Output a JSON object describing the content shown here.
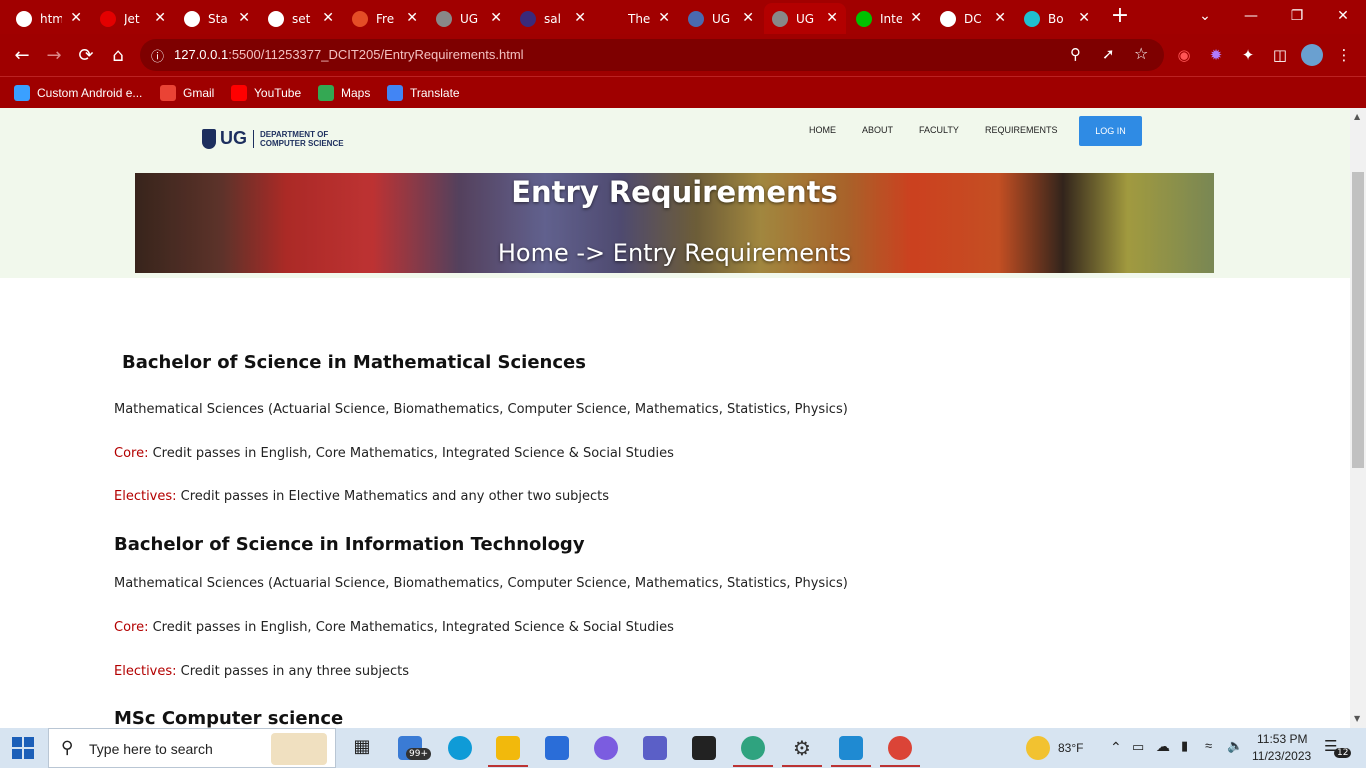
{
  "browser": {
    "tabs": [
      {
        "title": "htm",
        "icon": "google-icon",
        "color": "#ffffff"
      },
      {
        "title": "Jet",
        "icon": "swiss-flag-icon",
        "color": "#e30000"
      },
      {
        "title": "Sta",
        "icon": "github-icon",
        "color": "#ffffff"
      },
      {
        "title": "set",
        "icon": "google-icon",
        "color": "#ffffff"
      },
      {
        "title": "Fre",
        "icon": "html5-icon",
        "color": "#e44d26"
      },
      {
        "title": "UG",
        "icon": "globe-icon",
        "color": "#888888"
      },
      {
        "title": "sal",
        "icon": "ug-crest-icon",
        "color": "#3a2a7a"
      },
      {
        "title": "The",
        "icon": "blank-icon",
        "color": "#a10000"
      },
      {
        "title": "UG",
        "icon": "dcs-icon",
        "color": "#4a6ab0"
      },
      {
        "title": "UG",
        "icon": "globe-icon",
        "color": "#888888"
      },
      {
        "title": "Inte",
        "icon": "play-icon",
        "color": "#00c000"
      },
      {
        "title": "DC",
        "icon": "circle-icon",
        "color": "#ffffff"
      },
      {
        "title": "Bo",
        "icon": "cube-icon",
        "color": "#20c0d0"
      }
    ],
    "url_host": "127.0.0.1",
    "url_path": ":5500/11253377_DCIT205/EntryRequirements.html",
    "bookmarks": [
      {
        "label": "Custom Android e...",
        "color": "#3aa0ff"
      },
      {
        "label": "Gmail",
        "color": "#ea4335"
      },
      {
        "label": "YouTube",
        "color": "#ff0000"
      },
      {
        "label": "Maps",
        "color": "#34a853"
      },
      {
        "label": "Translate",
        "color": "#4285f4"
      }
    ]
  },
  "site": {
    "logo_text": "UG",
    "logo_dept_1": "DEPARTMENT OF",
    "logo_dept_2": "COMPUTER SCIENCE",
    "nav": [
      "HOME",
      "ABOUT",
      "FACULTY",
      "REQUIREMENTS"
    ],
    "login": "LOG IN",
    "hero_title": "Entry Requirements",
    "hero_crumb": "Home -> Entry Requirements"
  },
  "content": {
    "sections": [
      {
        "heading": "Bachelor of Science in Mathematical Sciences",
        "intro": "Mathematical Sciences (Actuarial Science, Biomathematics, Computer Science, Mathematics, Statistics, Physics)",
        "core_label": "Core:",
        "core": "Credit passes in English, Core Mathematics, Integrated Science & Social Studies",
        "electives_label": "Electives:",
        "electives": "Credit passes in Elective Mathematics and any other two subjects"
      },
      {
        "heading": "Bachelor of Science in Information Technology",
        "intro": "Mathematical Sciences (Actuarial Science, Biomathematics, Computer Science, Mathematics, Statistics, Physics)",
        "core_label": "Core:",
        "core": "Credit passes in English, Core Mathematics, Integrated Science & Social Studies",
        "electives_label": "Electives:",
        "electives": "Credit passes in any three subjects"
      },
      {
        "heading": "MSc Computer science"
      }
    ]
  },
  "taskbar": {
    "search_placeholder": "Type here to search",
    "mail_badge": "99+",
    "weather": "83°F",
    "time": "11:53 PM",
    "date": "11/23/2023",
    "notif_count": "12"
  }
}
